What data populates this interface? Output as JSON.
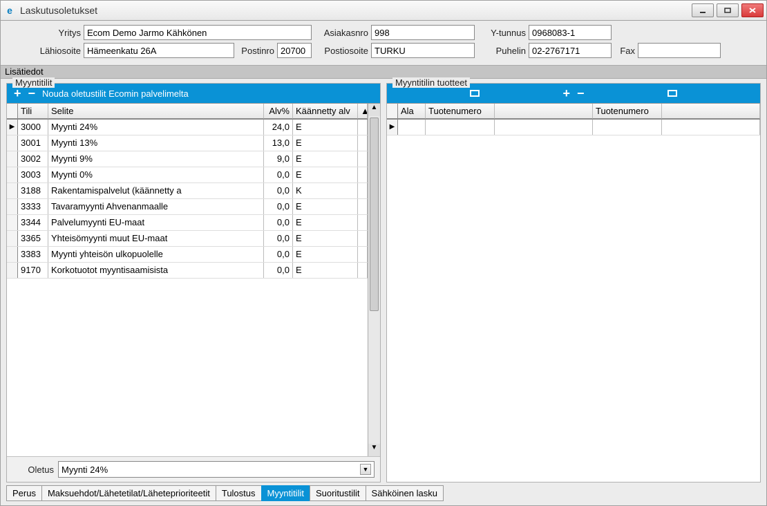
{
  "window": {
    "title": "Laskutusoletukset"
  },
  "header": {
    "labels": {
      "yritys": "Yritys",
      "asiakasnro": "Asiakasnro",
      "ytunnus": "Y-tunnus",
      "lahiosoite": "Lähiosoite",
      "postinro": "Postinro",
      "postiosoite": "Postiosoite",
      "puhelin": "Puhelin",
      "fax": "Fax"
    },
    "values": {
      "yritys": "Ecom Demo Jarmo Kähkönen",
      "asiakasnro": "998",
      "ytunnus": "0968083-1",
      "lahiosoite": "Hämeenkatu 26A",
      "postinro": "20700",
      "postiosoite": "TURKU",
      "puhelin": "02-2767171",
      "fax": ""
    }
  },
  "separator": "Lisätiedot",
  "left_group": {
    "legend": "Myyntitilit",
    "toolbar_fetch": "Nouda oletustilit Ecomin palvelimelta",
    "columns": {
      "tili": "Tili",
      "selite": "Selite",
      "alv": "Alv%",
      "kaan": "Käännetty alv"
    },
    "rows": [
      {
        "tili": "3000",
        "selite": "Myynti 24%",
        "alv": "24,0",
        "kaan": "E"
      },
      {
        "tili": "3001",
        "selite": "Myynti 13%",
        "alv": "13,0",
        "kaan": "E"
      },
      {
        "tili": "3002",
        "selite": "Myynti 9%",
        "alv": "9,0",
        "kaan": "E"
      },
      {
        "tili": "3003",
        "selite": "Myynti 0%",
        "alv": "0,0",
        "kaan": "E"
      },
      {
        "tili": "3188",
        "selite": "Rakentamispalvelut (käännetty a",
        "alv": "0,0",
        "kaan": "K"
      },
      {
        "tili": "3333",
        "selite": "Tavaramyynti Ahvenanmaalle",
        "alv": "0,0",
        "kaan": "E"
      },
      {
        "tili": "3344",
        "selite": "Palvelumyynti EU-maat",
        "alv": "0,0",
        "kaan": "E"
      },
      {
        "tili": "3365",
        "selite": "Yhteisömyynti muut EU-maat",
        "alv": "0,0",
        "kaan": "E"
      },
      {
        "tili": "3383",
        "selite": "Myynti yhteisön ulkopuolelle",
        "alv": "0,0",
        "kaan": "E"
      },
      {
        "tili": "9170",
        "selite": "Korkotuotot myyntisaamisista",
        "alv": "0,0",
        "kaan": "E"
      }
    ],
    "footer": {
      "label": "Oletus",
      "value": "Myynti 24%"
    }
  },
  "right_group": {
    "legend": "Myyntitilin tuotteet",
    "columns": {
      "ala": "Ala",
      "tn1": "Tuotenumero",
      "tn2": "Tuotenumero"
    }
  },
  "tabs": [
    {
      "label": "Perus",
      "active": false
    },
    {
      "label": "Maksuehdot/Lähetetilat/Läheteprioriteetit",
      "active": false
    },
    {
      "label": "Tulostus",
      "active": false
    },
    {
      "label": "Myyntitilit",
      "active": true
    },
    {
      "label": "Suoritustilit",
      "active": false
    },
    {
      "label": "Sähköinen lasku",
      "active": false
    }
  ]
}
